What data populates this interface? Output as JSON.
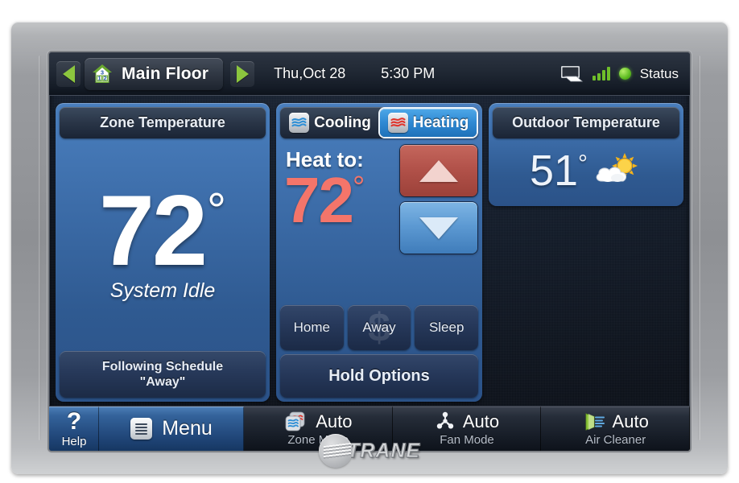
{
  "brand": {
    "name": "TRANE",
    "emblem_icon": "trane-emblem-icon"
  },
  "topbar": {
    "prev_zone_icon": "chevron-left-icon",
    "next_zone_icon": "chevron-right-icon",
    "house_icon": "house-zones-icon",
    "house_floor_numbers": [
      "3",
      "1",
      "2"
    ],
    "zone_name": "Main Floor",
    "date": "Thu,Oct 28",
    "time": "5:30 PM",
    "screen_icon": "display-screen-icon",
    "signal_icon": "signal-bars-icon",
    "signal_bars": 4,
    "status_dot_icon": "status-indicator-dot",
    "status_label": "Status",
    "status_color": "#6bc92c"
  },
  "zone_panel": {
    "header": "Zone Temperature",
    "temperature": "72",
    "degree": "°",
    "system_state": "System Idle",
    "schedule_line1": "Following Schedule",
    "schedule_line2": "\"Away\""
  },
  "setpoint_panel": {
    "tabs": [
      {
        "label": "Cooling",
        "icon": "cooling-waves-icon",
        "active": false,
        "wave_color": "#2f8fd6"
      },
      {
        "label": "Heating",
        "icon": "heating-waves-icon",
        "active": true,
        "wave_color": "#e0352c"
      }
    ],
    "setpoint_label": "Heat to:",
    "setpoint_value": "72",
    "setpoint_degree": "°",
    "setpoint_color": "#f4756a",
    "increase_icon": "arrow-up-icon",
    "decrease_icon": "arrow-down-icon",
    "presets": [
      {
        "label": "Home",
        "bg_icon": ""
      },
      {
        "label": "Away",
        "bg_icon": "$"
      },
      {
        "label": "Sleep",
        "bg_icon": ""
      }
    ],
    "hold_options": "Hold Options"
  },
  "outdoor_panel": {
    "header": "Outdoor Temperature",
    "temperature": "51",
    "degree": "°",
    "weather_icon": "partly-cloudy-icon"
  },
  "toolbar": {
    "help": {
      "glyph": "?",
      "label": "Help",
      "icon": "question-mark-icon"
    },
    "menu": {
      "label": "Menu",
      "icon": "menu-list-icon"
    },
    "modes": [
      {
        "value": "Auto",
        "name": "Zone Mode",
        "icon": "zone-mode-waves-icon"
      },
      {
        "value": "Auto",
        "name": "Fan Mode",
        "icon": "fan-blades-icon"
      },
      {
        "value": "Auto",
        "name": "Air Cleaner",
        "icon": "air-cleaner-filter-icon"
      }
    ]
  }
}
